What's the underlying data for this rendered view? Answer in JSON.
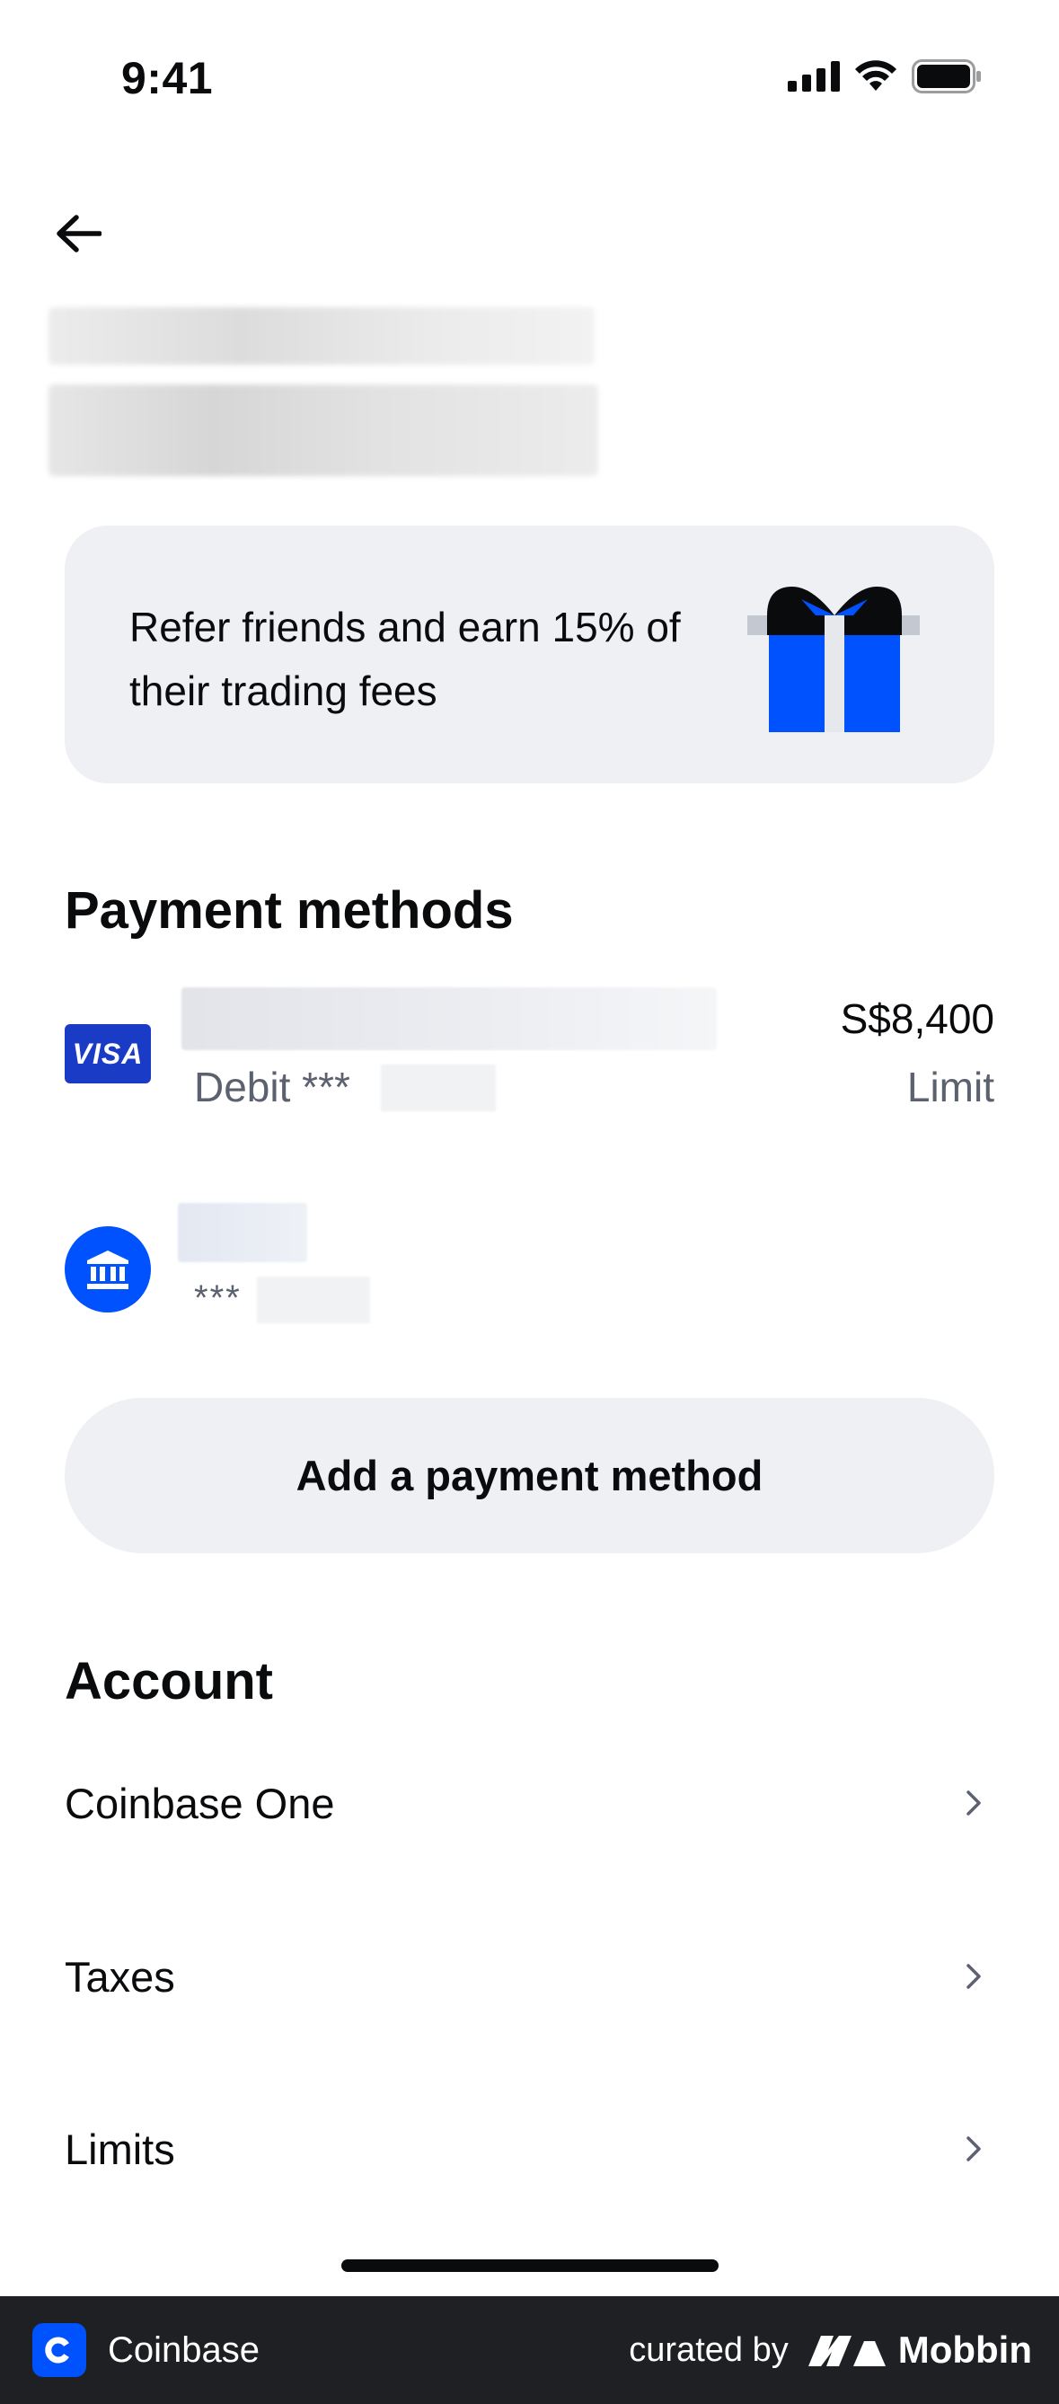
{
  "status_bar": {
    "time": "9:41",
    "icons": [
      "signal-icon",
      "wifi-icon",
      "battery-icon"
    ]
  },
  "header": {
    "back_icon": "arrow-left-icon"
  },
  "referral": {
    "text": "Refer friends and earn 15% of their trading fees",
    "icon": "gift-icon",
    "colors": {
      "gift_blue": "#0052ff",
      "ribbon_black": "#0a0b0d",
      "ribbon_grey": "#c4c8d0"
    }
  },
  "payment_methods": {
    "title": "Payment methods",
    "items": [
      {
        "logo": "VISA",
        "subtitle": "Debit ***",
        "amount": "S$8,400",
        "amount_label": "Limit"
      },
      {
        "icon": "bank-icon",
        "subtitle": "***"
      }
    ],
    "add_button": "Add a payment method"
  },
  "account": {
    "title": "Account",
    "items": [
      {
        "label": "Coinbase One"
      },
      {
        "label": "Taxes"
      },
      {
        "label": "Limits"
      }
    ]
  },
  "footer": {
    "brand": "Coinbase",
    "curated_by": "curated by",
    "mobbin": "Mobbin"
  },
  "theme": {
    "accent": "#0052ff",
    "card_bg": "#eef0f3",
    "text_primary": "#0a0b0d",
    "text_secondary": "#5b616e",
    "footer_bg": "#1f2023"
  }
}
